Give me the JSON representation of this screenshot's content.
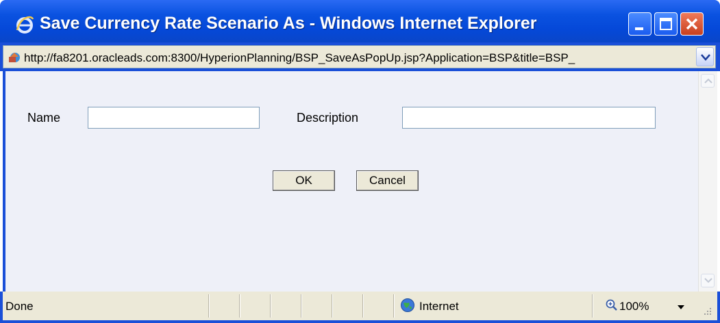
{
  "window": {
    "title": "Save Currency Rate Scenario As - Windows Internet Explorer",
    "controls": {
      "minimize": "minimize",
      "maximize": "maximize",
      "close": "close"
    }
  },
  "address_bar": {
    "url": "http://fa8201.oracleads.com:8300/HyperionPlanning/BSP_SaveAsPopUp.jsp?Application=BSP&title=BSP_"
  },
  "form": {
    "name_label": "Name",
    "name_value": "",
    "description_label": "Description",
    "description_value": "",
    "ok_label": "OK",
    "cancel_label": "Cancel"
  },
  "status_bar": {
    "status": "Done",
    "zone": "Internet",
    "zoom": "100%"
  },
  "colors": {
    "titlebar": "#0a52e0",
    "close_button": "#c8401e",
    "content_bg": "#eef0f8",
    "chrome": "#ece9d8"
  }
}
